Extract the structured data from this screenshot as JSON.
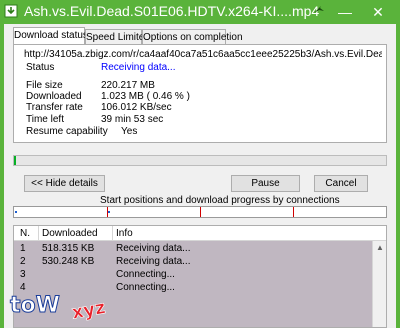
{
  "window": {
    "title": "Ash.vs.Evil.Dead.S01E06.HDTV.x264-KI....mp4",
    "minimize_glyph": "—",
    "close_glyph": "✕",
    "icons": {
      "app": "download-arrow-icon",
      "pin": "pin-icon"
    }
  },
  "tabs": [
    {
      "label": "Download status",
      "active": true
    },
    {
      "label": "Speed Limiter",
      "active": false
    },
    {
      "label": "Options on completion",
      "active": false
    }
  ],
  "status": {
    "url": "http://34105a.zbigz.com/r/ca4aaf40ca7a51c6aa5cc1eee25225b3/Ash.vs.Evil.Dead.S01E06.HDTV",
    "status_label": "Status",
    "status_value": "Receiving data...",
    "file_size_label": "File size",
    "file_size_value": "220.217  MB",
    "downloaded_label": "Downloaded",
    "downloaded_value": "1.023  MB  ( 0.46 % )",
    "transfer_rate_label": "Transfer rate",
    "transfer_rate_value": "106.012  KB/sec",
    "time_left_label": "Time left",
    "time_left_value": "39 min 53 sec",
    "resume_label": "Resume capability",
    "resume_value": "Yes",
    "progress_fraction": 0.0046
  },
  "buttons": {
    "hide_details": "<< Hide details",
    "pause": "Pause",
    "cancel": "Cancel"
  },
  "connections": {
    "label": "Start positions and download progress by connections",
    "segment_starts": [
      0.0,
      0.25,
      0.5,
      0.75
    ],
    "segment_progress": [
      0.0046,
      0.0046,
      0.0,
      0.0
    ]
  },
  "table": {
    "headers": {
      "n": "N.",
      "downloaded": "Downloaded",
      "info": "Info"
    },
    "rows": [
      {
        "n": "1",
        "downloaded": "518.315  KB",
        "info": "Receiving data..."
      },
      {
        "n": "2",
        "downloaded": "530.248  KB",
        "info": "Receiving data..."
      },
      {
        "n": "3",
        "downloaded": "",
        "info": "Connecting..."
      },
      {
        "n": "4",
        "downloaded": "",
        "info": "Connecting..."
      }
    ]
  },
  "watermark": {
    "text_main": "toW",
    "text_suffix": "xyz"
  },
  "colors": {
    "titlebar": "#5ab33b",
    "status_blue": "#0000ff",
    "table_bg": "#c0b7c1",
    "connection_marker": "#d00000",
    "connection_progress": "#1f5fd0"
  }
}
